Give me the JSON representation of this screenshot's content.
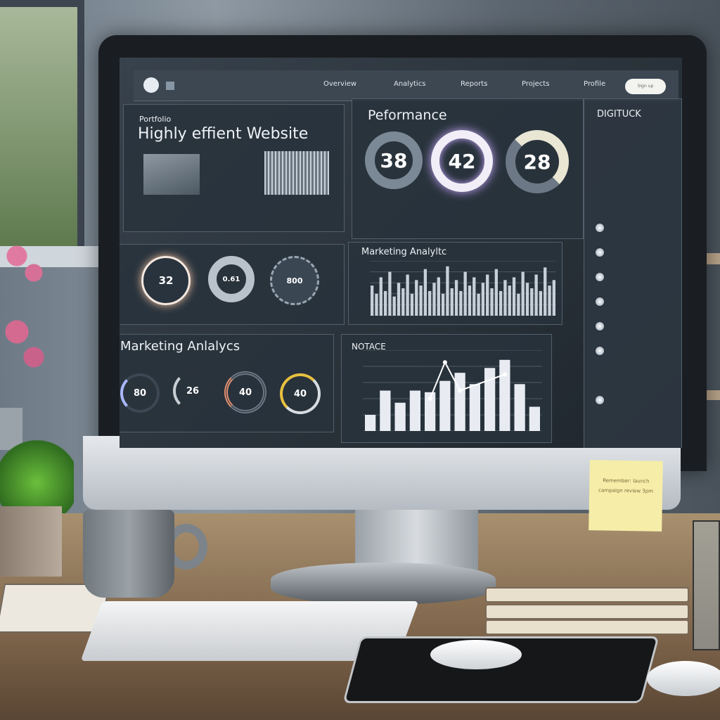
{
  "dashboard": {
    "topbar": {
      "nav": [
        "Overview",
        "Analytics",
        "Reports",
        "Projects",
        "Profile"
      ],
      "button_label": "Sign up"
    },
    "hero": {
      "eyebrow": "Portfolio",
      "title": "Highly effient Website"
    },
    "performance": {
      "title": "Peformance",
      "gauges": [
        {
          "value": "38",
          "fill": 0.75
        },
        {
          "value": "42",
          "fill": 1.0
        },
        {
          "value": "28",
          "fill": 0.35
        }
      ],
      "accent": "#c8a8ff"
    },
    "mini_gauges": [
      "32",
      "0.61",
      "800"
    ],
    "marketing_chart": {
      "title": "Marketing Analyltc"
    },
    "marketing_gauges": {
      "title": "Marketing Anlalycs",
      "values": [
        "80",
        "26",
        "40",
        "40"
      ]
    },
    "sidebar": {
      "title": "DIGITUCK"
    },
    "notace_chart": {
      "title": "NOTACE"
    }
  },
  "chart_data": [
    {
      "type": "bar",
      "title": "Marketing Analyltc",
      "values": [
        55,
        40,
        70,
        45,
        80,
        35,
        60,
        50,
        75,
        40,
        65,
        55,
        85,
        45,
        60,
        70,
        40,
        90,
        50,
        65,
        45,
        80,
        55,
        70,
        40,
        60,
        75,
        50,
        85,
        45,
        65,
        55,
        70,
        40,
        80,
        60,
        50,
        75,
        45,
        88,
        55,
        65
      ]
    },
    {
      "type": "bar",
      "title": "NOTACE",
      "values": [
        20,
        50,
        35,
        50,
        48,
        62,
        72,
        58,
        78,
        88,
        58,
        30
      ],
      "line": [
        null,
        null,
        null,
        null,
        40,
        85,
        50,
        null,
        null,
        70,
        null,
        null
      ]
    }
  ],
  "sticky_note": "Remember: launch campaign review 3pm"
}
